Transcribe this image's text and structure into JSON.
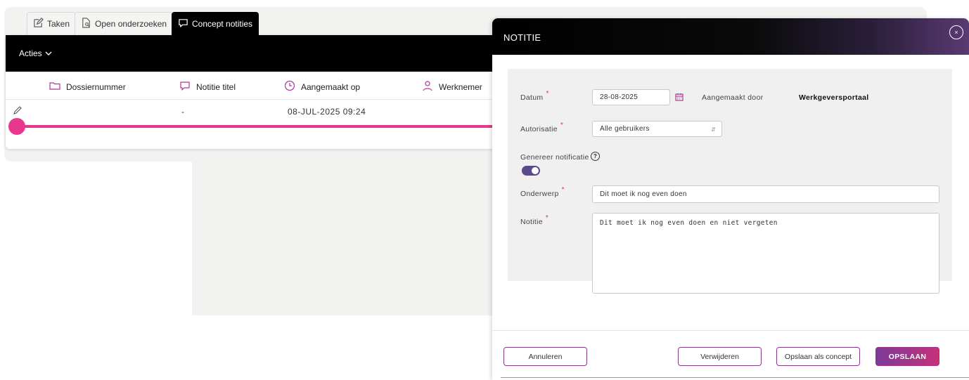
{
  "tabs": [
    {
      "label": "Taken",
      "icon": "edit-icon"
    },
    {
      "label": "Open onderzoeken",
      "icon": "document-search-icon"
    },
    {
      "label": "Concept notities",
      "icon": "speech-bubble-icon"
    }
  ],
  "list": {
    "actions_label": "Acties",
    "columns": [
      {
        "label": "Dossiernummer",
        "icon": "folder-icon"
      },
      {
        "label": "Notitie titel",
        "icon": "speech-bubble-icon"
      },
      {
        "label": "Aangemaakt op",
        "icon": "clock-icon"
      },
      {
        "label": "Werknemer",
        "icon": "person-icon"
      }
    ],
    "rows": [
      {
        "dossiernummer": "",
        "titel": "-",
        "aangemaakt_op": "08-JUL-2025 09:24",
        "werknemer": ""
      }
    ]
  },
  "modal": {
    "title": "NOTITIE",
    "close_label": "×",
    "datum_label": "Datum",
    "datum_value": "28-08-2025",
    "aangemaakt_door_label": "Aangemaakt door",
    "aangemaakt_door_value": "Werkgeversportaal",
    "autorisatie_label": "Autorisatie",
    "autorisatie_value": "Alle gebruikers",
    "genereer_label": "Genereer notificatie",
    "genereer_on": true,
    "help_label": "?",
    "onderwerp_label": "Onderwerp",
    "onderwerp_value": "Dit moet ik nog even doen",
    "notitie_label": "Notitie",
    "notitie_value": "Dit moet ik nog even doen en niet vergeten",
    "required_mark": "*"
  },
  "buttons": {
    "cancel": "Annuleren",
    "delete": "Verwijderen",
    "save_concept": "Opslaan als concept",
    "save": "OPSLAAN"
  },
  "colors": {
    "accent_pink": "#e8378f",
    "primary_gradient_start": "#7a3a9a",
    "primary_gradient_end": "#c8307a",
    "toggle": "#5a4a8c",
    "header_bg": "#000000"
  }
}
